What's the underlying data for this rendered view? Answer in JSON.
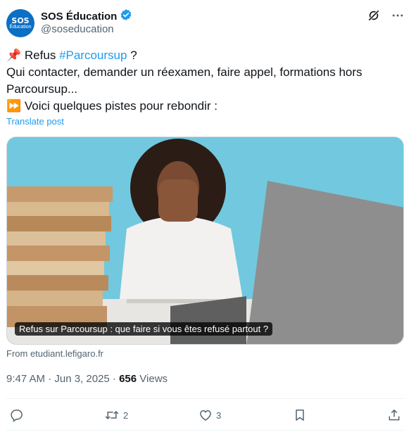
{
  "author": {
    "avatar_line1": "SOS",
    "avatar_line2": "Éducation",
    "name": "SOS Éducation",
    "handle": "@soseducation"
  },
  "icons": {
    "grok": "grok-icon",
    "more": "more-icon",
    "verified": "verified-badge-icon",
    "pin": "pushpin-emoji",
    "fast_forward": "fast-forward-emoji"
  },
  "tweet": {
    "pin_emoji": "📌",
    "line1_text": "Refus",
    "hashtag": "#Parcoursup",
    "line1_end": "?",
    "line2": "Qui contacter, demander un réexamen, faire appel, formations hors",
    "line3": "Parcoursup...",
    "ff_emoji": "⏩",
    "line4": "Voici quelques pistes pour rebondir :"
  },
  "translate": "Translate post",
  "card": {
    "title": "Refus sur Parcoursup : que faire si vous êtes refusé partout ?",
    "from": "From etudiant.lefigaro.fr"
  },
  "meta": {
    "time": "9:47 AM · Jun 3, 2025 · ",
    "views_count": "656",
    "views_label": " Views"
  },
  "actions": {
    "reply_count": "",
    "retweet_count": "2",
    "like_count": "3"
  },
  "colors": {
    "accent": "#1d9bf0",
    "muted": "#536471",
    "text": "#0f1419"
  }
}
